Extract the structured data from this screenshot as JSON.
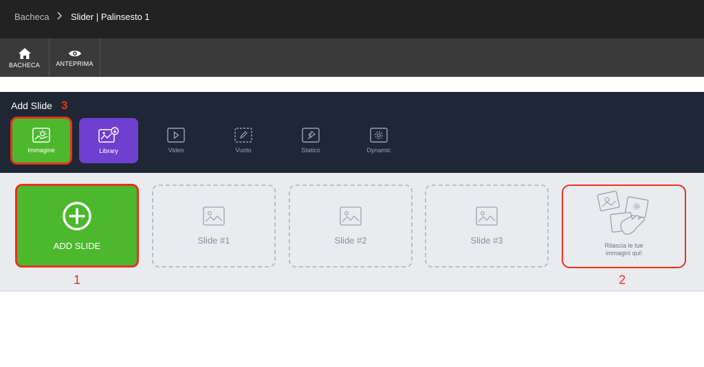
{
  "breadcrumb": {
    "root": "Bacheca",
    "current": "Slider | Palinsesto 1"
  },
  "toolbar": {
    "home_label": "BACHECA",
    "preview_label": "ANTEPRIMA"
  },
  "add_panel": {
    "title": "Add Slide",
    "annotation": "3",
    "types": [
      {
        "label": "Immagine",
        "icon": "image-sun-icon"
      },
      {
        "label": "Library",
        "icon": "image-download-icon"
      },
      {
        "label": "Video",
        "icon": "play-icon"
      },
      {
        "label": "Vuoto",
        "icon": "pencil-dashed-icon"
      },
      {
        "label": "Statico",
        "icon": "pin-icon"
      },
      {
        "label": "Dynamic",
        "icon": "gear-icon"
      }
    ]
  },
  "slides": {
    "add_label": "ADD SLIDE",
    "add_annotation": "1",
    "items": [
      {
        "label": "Slide #1"
      },
      {
        "label": "Slide #2"
      },
      {
        "label": "Slide #3"
      }
    ],
    "drop_line1": "Rilascia le tue",
    "drop_line2": "immagini qui!",
    "drop_annotation": "2"
  },
  "colors": {
    "accent_green": "#4db82e",
    "accent_purple": "#6f3fd0",
    "annotation_red": "#e8321e",
    "panel_bg": "#1f2734"
  }
}
